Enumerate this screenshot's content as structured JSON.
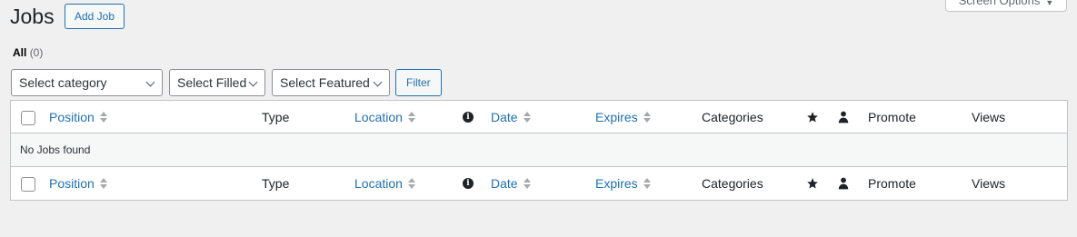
{
  "header": {
    "title": "Jobs",
    "add_button": "Add Job",
    "screen_options": "Screen Options"
  },
  "views": {
    "all_label": "All",
    "all_count": "(0)"
  },
  "filters": {
    "category": "Select category",
    "filled": "Select Filled",
    "featured": "Select Featured",
    "filter_button": "Filter"
  },
  "columns": {
    "position": "Position",
    "type": "Type",
    "location": "Location",
    "date": "Date",
    "expires": "Expires",
    "categories": "Categories",
    "promote": "Promote",
    "views": "Views"
  },
  "icons": {
    "info": "info-icon",
    "featured": "star-icon",
    "filled": "person-icon"
  },
  "empty_message": "No Jobs found",
  "colors": {
    "link": "#2271b1",
    "background": "#f0f0f1"
  }
}
